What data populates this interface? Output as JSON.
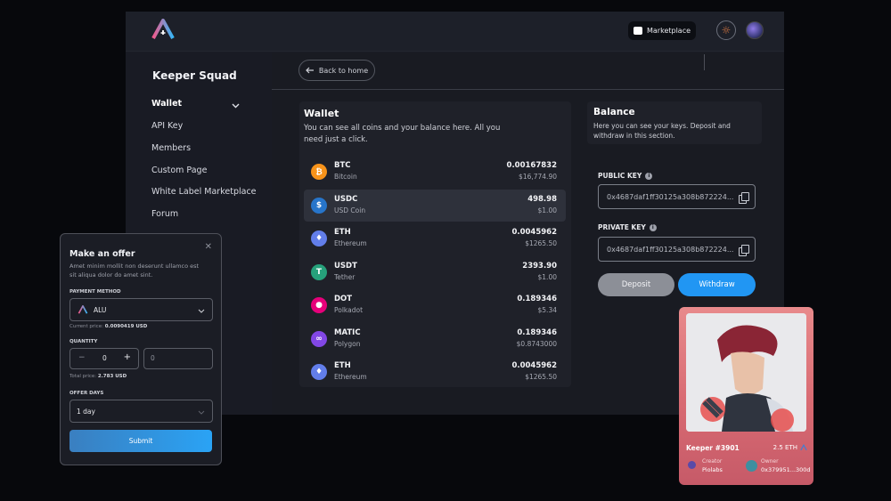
{
  "header": {
    "marketplace_label": "Marketplace",
    "icons": {
      "logo": "alu-logo-icon",
      "marketplace": "store-icon",
      "settings": "gear-icon",
      "avatar": "avatar"
    }
  },
  "sidebar": {
    "team_name": "Keeper Squad",
    "items": [
      {
        "label": "Wallet",
        "active": true
      },
      {
        "label": "API Key"
      },
      {
        "label": "Members"
      },
      {
        "label": "Custom Page"
      },
      {
        "label": "White Label Marketplace"
      },
      {
        "label": "Forum"
      }
    ]
  },
  "main": {
    "back_label": "Back to home",
    "wallet": {
      "title": "Wallet",
      "description": "You can see all coins and your balance here. All you need just a click.",
      "coins": [
        {
          "symbol": "BTC",
          "name": "Bitcoin",
          "amount": "0.00167832",
          "usd": "$16,774.90",
          "color": "#f7931a",
          "glyph": "₿"
        },
        {
          "symbol": "USDC",
          "name": "USD Coin",
          "amount": "498.98",
          "usd": "$1.00",
          "color": "#2775ca",
          "glyph": "$",
          "selected": true
        },
        {
          "symbol": "ETH",
          "name": "Ethereum",
          "amount": "0.0045962",
          "usd": "$1265.50",
          "color": "#627eea",
          "glyph": "♦"
        },
        {
          "symbol": "USDT",
          "name": "Tether",
          "amount": "2393.90",
          "usd": "$1.00",
          "color": "#26a17b",
          "glyph": "T"
        },
        {
          "symbol": "DOT",
          "name": "Polkadot",
          "amount": "0.189346",
          "usd": "$5.34",
          "color": "#e6007a",
          "glyph": "●"
        },
        {
          "symbol": "MATIC",
          "name": "Polygon",
          "amount": "0.189346",
          "usd": "$0.8743000",
          "color": "#8247e5",
          "glyph": "∞"
        },
        {
          "symbol": "ETH",
          "name": "Ethereum",
          "amount": "0.0045962",
          "usd": "$1265.50",
          "color": "#627eea",
          "glyph": "♦"
        }
      ]
    },
    "balance": {
      "title": "Balance",
      "description": "Here you can see your keys. Deposit and withdraw in this section.",
      "public_key_label": "PUBLIC KEY",
      "public_key": "0x4687daf1ff30125a308b872224...",
      "private_key_label": "PRIVATE KEY",
      "private_key": "0x4687daf1ff30125a308b872224...",
      "deposit_label": "Deposit",
      "withdraw_label": "Withdraw"
    }
  },
  "offer": {
    "title": "Make an offer",
    "description": "Amet minim mollit non deserunt ullamco est sit aliqua dolor do amet sint.",
    "payment_method_label": "PAYMENT METHOD",
    "payment_method_value": "ALU",
    "current_price_label": "Current price:",
    "current_price_value": "0.0090419 USD",
    "quantity_label": "QUANTITY",
    "quantity_value": "0",
    "quantity_placeholder": "0",
    "total_price_label": "Total price:",
    "total_price_value": "2.783 USD",
    "offer_days_label": "OFFER DAYS",
    "offer_days_value": "1 day",
    "submit_label": "Submit"
  },
  "nft": {
    "name": "Keeper #3901",
    "price": "2.5 ETH",
    "creator_label": "Creator",
    "creator_value": "Piolabs",
    "owner_label": "Owner",
    "owner_value": "0x379951...300d"
  }
}
